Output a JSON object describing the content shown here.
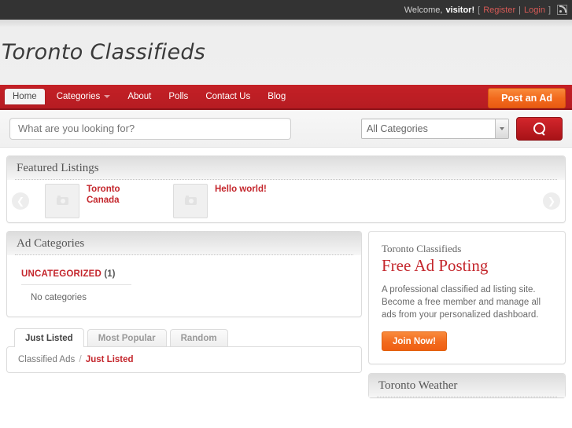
{
  "topbar": {
    "welcome": "Welcome,",
    "visitor": "visitor!",
    "open_bracket": "[",
    "register": "Register",
    "divider": "|",
    "login": "Login",
    "close_bracket": "]",
    "rss_icon": "rss-icon"
  },
  "header": {
    "logo": "Toronto Classifieds"
  },
  "nav": {
    "items": [
      {
        "label": "Home",
        "active": true,
        "caret": false
      },
      {
        "label": "Categories",
        "active": false,
        "caret": true
      },
      {
        "label": "About",
        "active": false,
        "caret": false
      },
      {
        "label": "Polls",
        "active": false,
        "caret": false
      },
      {
        "label": "Contact Us",
        "active": false,
        "caret": false
      },
      {
        "label": "Blog",
        "active": false,
        "caret": false
      }
    ],
    "post_ad": "Post an Ad"
  },
  "search": {
    "placeholder": "What are you looking for?",
    "value": "",
    "category_selected": "All Categories",
    "category_options": [
      "All Categories"
    ],
    "button_icon": "search-icon"
  },
  "featured": {
    "title": "Featured Listings",
    "prev_icon": "chevron-left-icon",
    "next_icon": "chevron-right-icon",
    "items": [
      {
        "title": "Toronto Canada",
        "thumb_icon": "camera-placeholder-icon"
      },
      {
        "title": "Hello world!",
        "thumb_icon": "camera-placeholder-icon"
      }
    ]
  },
  "ad_categories": {
    "title": "Ad Categories",
    "entries": [
      {
        "name": "UNCATEGORIZED",
        "count": "(1)"
      }
    ],
    "empty_text": "No categories"
  },
  "listing_tabs": {
    "tabs": [
      {
        "label": "Just Listed",
        "active": true
      },
      {
        "label": "Most Popular",
        "active": false
      },
      {
        "label": "Random",
        "active": false
      }
    ],
    "breadcrumb_root": "Classified Ads",
    "breadcrumb_sep": "/",
    "breadcrumb_current": "Just Listed"
  },
  "promo": {
    "kicker": "Toronto Classifieds",
    "heading": "Free Ad Posting",
    "body": "A professional classified ad listing site. Become a free member and manage all ads from your personalized dashboard.",
    "cta": "Join Now!"
  },
  "weather": {
    "title": "Toronto Weather"
  },
  "colors": {
    "brand_red": "#c4262c",
    "dark_red": "#8e1419",
    "orange": "#f26a1d",
    "topbar_bg": "#333333",
    "link_red": "#d65a56"
  }
}
